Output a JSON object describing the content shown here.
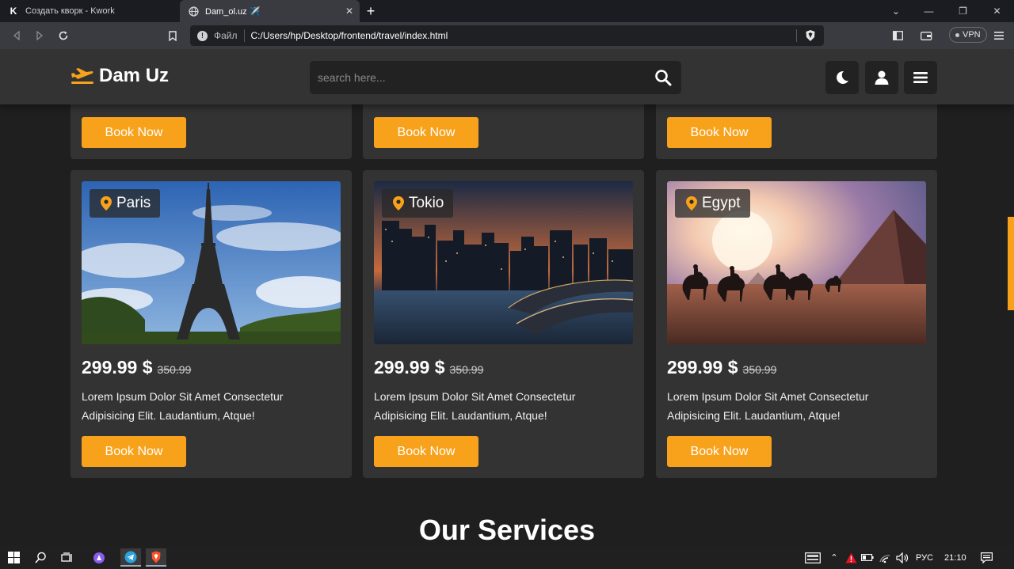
{
  "browser": {
    "tabs": [
      {
        "title": "Создать кворк - Kwork",
        "favicon": "kwork-k-logo",
        "active": false
      },
      {
        "title": "Dam_ol.uz ✈️",
        "favicon": "globe-icon",
        "active": true
      }
    ],
    "new_tab": "+",
    "address": {
      "scheme_label": "Файл",
      "url": "C:/Users/hp/Desktop/frontend/travel/index.html"
    },
    "vpn_label": "VPN"
  },
  "site": {
    "logo": "Dam Uz",
    "search_placeholder": "search here...",
    "header_buttons": [
      "moon-icon",
      "user-icon",
      "menu-icon"
    ],
    "accent_color": "#f8a21c",
    "top_cards": [
      {
        "button": "Book Now"
      },
      {
        "button": "Book Now"
      },
      {
        "button": "Book Now"
      }
    ],
    "cards": [
      {
        "location": "Paris",
        "price": "299.99 $",
        "old_price": "350.99",
        "description": "Lorem Ipsum Dolor Sit Amet Consectetur Adipisicing Elit. Laudantium, Atque!",
        "button": "Book Now"
      },
      {
        "location": "Tokio",
        "price": "299.99 $",
        "old_price": "350.99",
        "description": "Lorem Ipsum Dolor Sit Amet Consectetur Adipisicing Elit. Laudantium, Atque!",
        "button": "Book Now"
      },
      {
        "location": "Egypt",
        "price": "299.99 $",
        "old_price": "350.99",
        "description": "Lorem Ipsum Dolor Sit Amet Consectetur Adipisicing Elit. Laudantium, Atque!",
        "button": "Book Now"
      }
    ],
    "services_heading": {
      "part1": "Our",
      "part2": "Services"
    }
  },
  "taskbar": {
    "language": "РУС",
    "time": "21:10"
  }
}
